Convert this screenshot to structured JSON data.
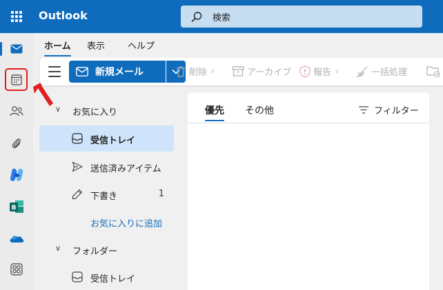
{
  "header": {
    "app_title": "Outlook",
    "search_placeholder": "検索",
    "color": "#0f6cbd"
  },
  "rail": {
    "items": [
      {
        "name": "mail-icon",
        "active": true
      },
      {
        "name": "calendar-icon",
        "highlighted": true
      },
      {
        "name": "people-icon"
      },
      {
        "name": "attachment-icon"
      },
      {
        "name": "copilot-icon"
      },
      {
        "name": "bookings-icon"
      },
      {
        "name": "onedrive-icon"
      },
      {
        "name": "more-apps-icon"
      }
    ]
  },
  "ribbon": {
    "tabs": [
      "ホーム",
      "表示",
      "ヘルプ"
    ],
    "selected_tab": "ホーム"
  },
  "toolbar": {
    "new_mail_label": "新規メール",
    "delete_label": "削除",
    "archive_label": "アーカイブ",
    "report_label": "報告",
    "sweep_label": "一括処理"
  },
  "folders": {
    "favorites_label": "お気に入り",
    "favorites": [
      {
        "label": "受信トレイ",
        "selected": true
      },
      {
        "label": "送信済みアイテム"
      },
      {
        "label": "下書き",
        "count": "1"
      }
    ],
    "add_favorite_label": "お気に入りに追加",
    "folders_label": "フォルダー",
    "folder_items": [
      {
        "label": "受信トレイ"
      }
    ]
  },
  "maillist": {
    "tabs": [
      "優先",
      "その他"
    ],
    "selected_tab": "優先",
    "filter_label": "フィルター"
  },
  "annotation_color": "#e01e1e"
}
